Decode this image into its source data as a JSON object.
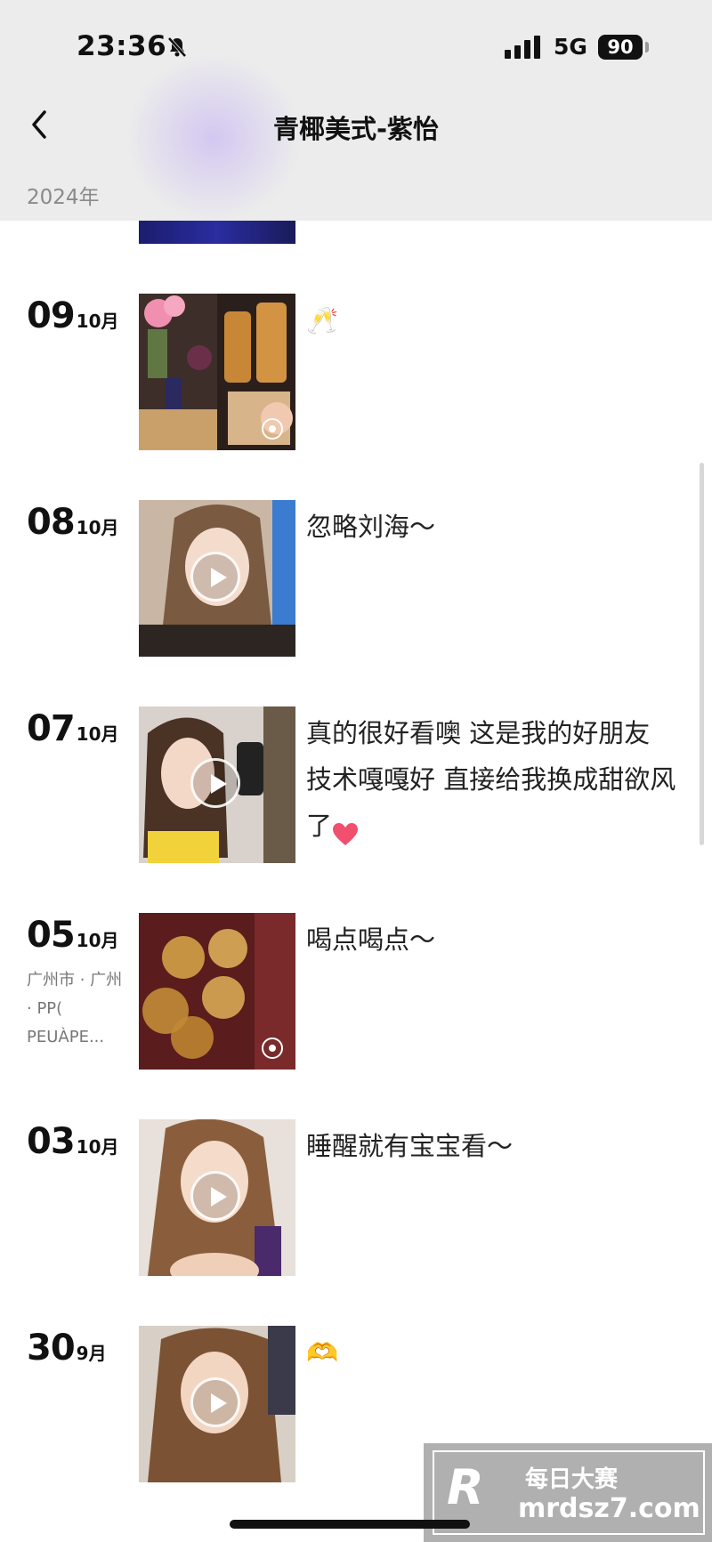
{
  "status_bar": {
    "time": "23:36",
    "network": "5G",
    "battery": "90"
  },
  "header": {
    "title": "青椰美式-紫怡",
    "year_label": "2024年"
  },
  "posts": [
    {
      "day": "09",
      "month": "10月",
      "location": "",
      "caption": "🥂",
      "media": "live-photo"
    },
    {
      "day": "08",
      "month": "10月",
      "location": "",
      "caption": "忽略刘海～",
      "media": "video"
    },
    {
      "day": "07",
      "month": "10月",
      "location": "",
      "caption": "真的很好看噢 这是我的好朋友 技术嘎嘎好 直接给我换成甜欲风了",
      "media": "video"
    },
    {
      "day": "05",
      "month": "10月",
      "location": "广州市 · 广州 · PP( PEUÀPE...",
      "caption": "喝点喝点～",
      "media": "live-photo"
    },
    {
      "day": "03",
      "month": "10月",
      "location": "",
      "caption": "睡醒就有宝宝看～",
      "media": "video"
    },
    {
      "day": "30",
      "month": "9月",
      "location": "",
      "caption": "🫶",
      "media": "video"
    }
  ],
  "watermark": {
    "logo": "R",
    "cn": "每日大赛",
    "url": "mrdsz7.com"
  },
  "colors": {
    "header_bg": "#ececec",
    "heart": "#f0506e"
  }
}
